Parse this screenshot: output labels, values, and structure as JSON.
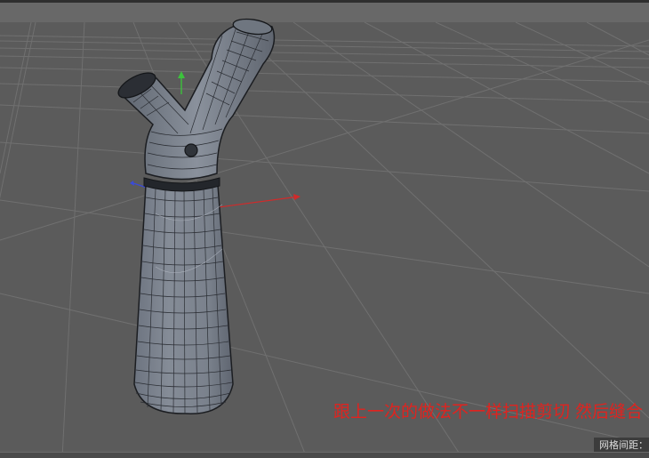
{
  "viewport": {
    "annotation": "跟上一次的做法不一样扫描剪切 然后缝合",
    "grid_spacing_label": "网格间距："
  },
  "colors": {
    "background": "#5b5b5b",
    "grid_line": "#6e6e6e",
    "annotation": "#e0231f",
    "axis_x": "#d22a2a",
    "axis_y": "#3cc23c",
    "axis_z": "#3a4bd8"
  },
  "icons": [
    "y-axis-gizmo-icon",
    "x-axis-gizmo-icon",
    "z-axis-gizmo-icon"
  ]
}
